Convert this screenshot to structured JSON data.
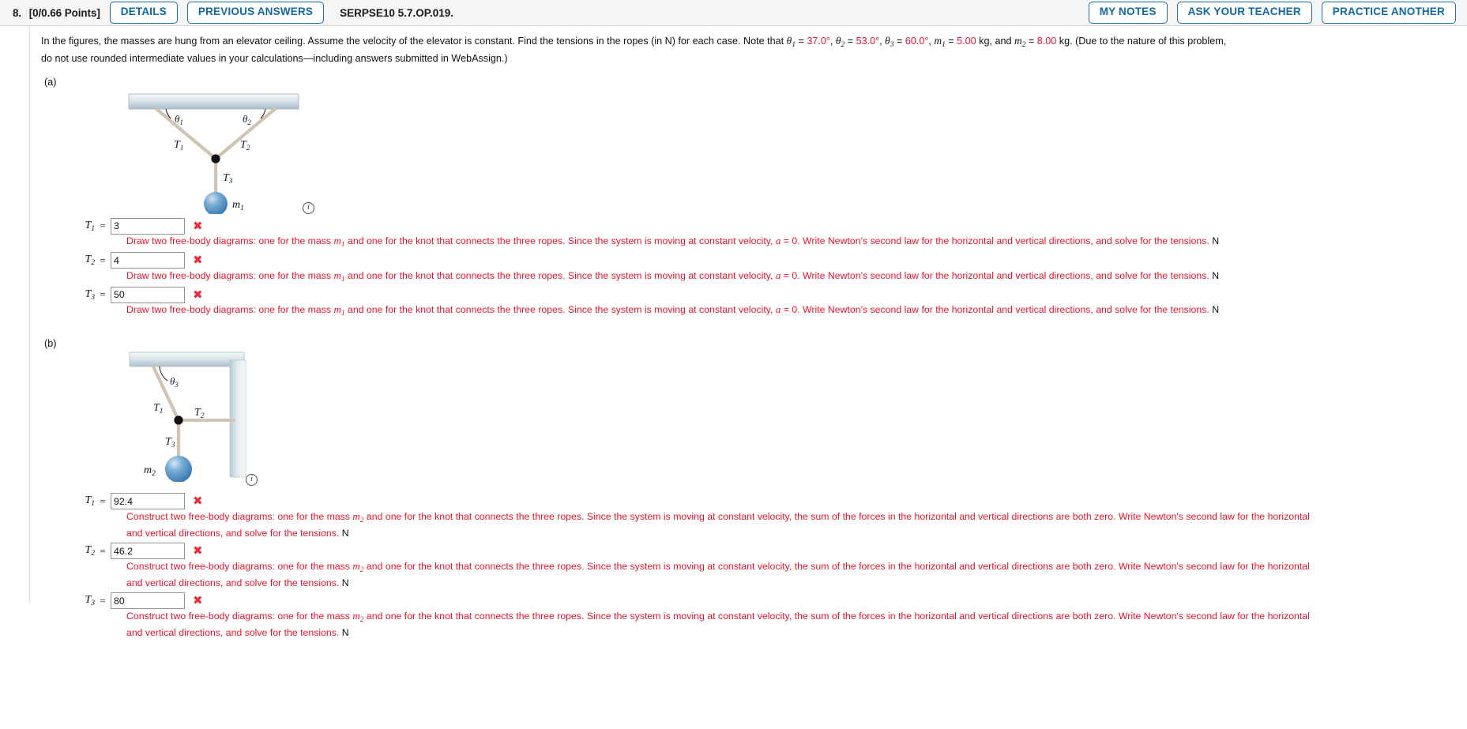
{
  "header": {
    "question_number": "8.",
    "points": "[0/0.66 Points]",
    "details_label": "DETAILS",
    "previous_answers_label": "PREVIOUS ANSWERS",
    "question_code": "SERPSE10 5.7.OP.019.",
    "my_notes_label": "MY NOTES",
    "ask_teacher_label": "ASK YOUR TEACHER",
    "practice_another_label": "PRACTICE ANOTHER",
    "accent_color": "#1167a6"
  },
  "stem": {
    "p1": "In the figures, the masses are hung from an elevator ceiling. Assume the velocity of the elevator is constant. Find the tensions in the ropes (in N) for each case. Note that ",
    "theta1_sym": "θ",
    "theta1_sub": "1",
    "theta1_val": "37.0°",
    "theta2_sym": "θ",
    "theta2_sub": "2",
    "theta2_val": "53.0°",
    "theta3_sym": "θ",
    "theta3_sub": "3",
    "theta3_val": "60.0°",
    "m1_sym": "m",
    "m1_sub": "1",
    "m1_val": "5.00",
    "m2_sym": "m",
    "m2_sub": "2",
    "m2_val": "8.00",
    "kg": " kg",
    "comma": ", ",
    "eq": " = ",
    "and": ", and ",
    "tail": " kg. (Due to the nature of this problem, do not use rounded intermediate values in your calculations—including answers submitted in WebAssign.)",
    "red_color": "#e8142c"
  },
  "parts": [
    {
      "label": "(a)",
      "figure": {
        "name": "two-rope-ceiling-figure",
        "labels": {
          "theta1": "θ",
          "theta1_sub": "1",
          "theta2": "θ",
          "theta2_sub": "2",
          "T1": "T",
          "T1_sub": "1",
          "T2": "T",
          "T2_sub": "2",
          "T3": "T",
          "T3_sub": "3",
          "mass": "m",
          "mass_sub": "1"
        }
      },
      "answers": [
        {
          "symbol": "T",
          "sub": "1",
          "equals": "=",
          "value": "3",
          "status": "incorrect",
          "status_mark": "✖",
          "feedback_pre": "Draw two free-body diagrams: one for the mass ",
          "feedback_m": "m",
          "feedback_m_sub": "1",
          "feedback_mid": " and one for the knot that connects the three ropes. Since the system is moving at constant velocity, ",
          "feedback_a": "a",
          "feedback_post": " = 0. Write Newton's second law for the horizontal and vertical directions, and solve for the tensions.",
          "unit": "N"
        },
        {
          "symbol": "T",
          "sub": "2",
          "equals": "=",
          "value": "4",
          "status": "incorrect",
          "status_mark": "✖",
          "feedback_pre": "Draw two free-body diagrams: one for the mass ",
          "feedback_m": "m",
          "feedback_m_sub": "1",
          "feedback_mid": " and one for the knot that connects the three ropes. Since the system is moving at constant velocity, ",
          "feedback_a": "a",
          "feedback_post": " = 0. Write Newton's second law for the horizontal and vertical directions, and solve for the tensions.",
          "unit": "N"
        },
        {
          "symbol": "T",
          "sub": "3",
          "equals": "=",
          "value": "50",
          "status": "incorrect",
          "status_mark": "✖",
          "feedback_pre": "Draw two free-body diagrams: one for the mass ",
          "feedback_m": "m",
          "feedback_m_sub": "1",
          "feedback_mid": " and one for the knot that connects the three ropes. Since the system is moving at constant velocity, ",
          "feedback_a": "a",
          "feedback_post": " = 0. Write Newton's second law for the horizontal and vertical directions, and solve for the tensions.",
          "unit": "N"
        }
      ]
    },
    {
      "label": "(b)",
      "figure": {
        "name": "corner-wall-rope-figure",
        "labels": {
          "theta3": "θ",
          "theta3_sub": "3",
          "T1": "T",
          "T1_sub": "1",
          "T2": "T",
          "T2_sub": "2",
          "T3": "T",
          "T3_sub": "3",
          "mass": "m",
          "mass_sub": "2"
        }
      },
      "answers": [
        {
          "symbol": "T",
          "sub": "1",
          "equals": "=",
          "value": "92.4",
          "status": "incorrect",
          "status_mark": "✖",
          "feedback_pre": "Construct two free-body diagrams: one for the mass ",
          "feedback_m": "m",
          "feedback_m_sub": "2",
          "feedback_mid": " and one for the knot that connects the three ropes. Since the system is moving at constant velocity, the sum of the forces in the horizontal and vertical directions are both zero. Write Newton's second law for the horizontal and vertical directions, and solve for the tensions.",
          "unit": "N"
        },
        {
          "symbol": "T",
          "sub": "2",
          "equals": "=",
          "value": "46.2",
          "status": "incorrect",
          "status_mark": "✖",
          "feedback_pre": "Construct two free-body diagrams: one for the mass ",
          "feedback_m": "m",
          "feedback_m_sub": "2",
          "feedback_mid": " and one for the knot that connects the three ropes. Since the system is moving at constant velocity, the sum of the forces in the horizontal and vertical directions are both zero. Write Newton's second law for the horizontal and vertical directions, and solve for the tensions.",
          "unit": "N"
        },
        {
          "symbol": "T",
          "sub": "3",
          "equals": "=",
          "value": "80",
          "status": "incorrect",
          "status_mark": "✖",
          "feedback_pre": "Construct two free-body diagrams: one for the mass ",
          "feedback_m": "m",
          "feedback_m_sub": "2",
          "feedback_mid": " and one for the knot that connects the three ropes. Since the system is moving at constant velocity, the sum of the forces in the horizontal and vertical directions are both zero. Write Newton's second law for the horizontal and vertical directions, and solve for the tensions.",
          "unit": "N"
        }
      ]
    }
  ],
  "info_icon": "i"
}
